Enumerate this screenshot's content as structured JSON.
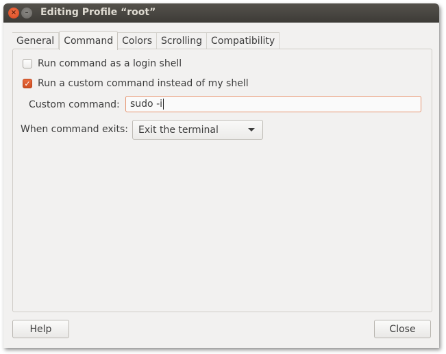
{
  "window": {
    "title": "Editing Profile “root”",
    "close_glyph": "×",
    "minimize_glyph": "–"
  },
  "tabs": [
    {
      "label": "General",
      "active": false
    },
    {
      "label": "Command",
      "active": true
    },
    {
      "label": "Colors",
      "active": false
    },
    {
      "label": "Scrolling",
      "active": false
    },
    {
      "label": "Compatibility",
      "active": false
    }
  ],
  "command": {
    "login_shell": {
      "label": "Run command as a login shell",
      "checked": false
    },
    "custom_command_toggle": {
      "label": "Run a custom command instead of my shell",
      "checked": true,
      "check_glyph": "✓"
    },
    "custom_command": {
      "label": "Custom command:",
      "value": "sudo -i"
    },
    "on_exit": {
      "label": "When command exits:",
      "selected": "Exit the terminal"
    }
  },
  "footer": {
    "help_label": "Help",
    "close_label": "Close"
  },
  "colors": {
    "accent": "#dd4814",
    "titlebar": "#3d3b37",
    "background": "#f2f1f0"
  }
}
